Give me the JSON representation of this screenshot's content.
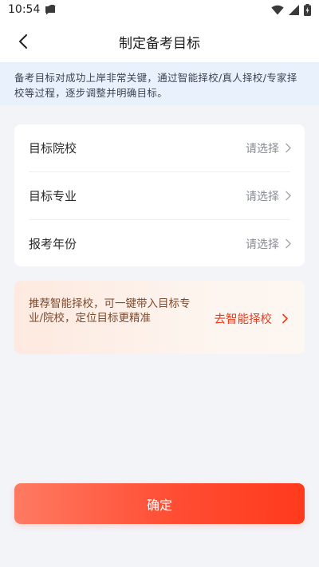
{
  "status_bar": {
    "time": "10:54"
  },
  "nav": {
    "title": "制定备考目标"
  },
  "notice": {
    "text": "备考目标对成功上岸非常关键，通过智能择校/真人择校/专家择校等过程，逐步调整并明确目标。"
  },
  "form": {
    "rows": [
      {
        "label": "目标院校",
        "value": "请选择"
      },
      {
        "label": "目标专业",
        "value": "请选择"
      },
      {
        "label": "报考年份",
        "value": "请选择"
      }
    ]
  },
  "promo": {
    "text": "推荐智能择校，可一键带入目标专业/院校，定位目标更精准",
    "cta": "去智能择校"
  },
  "confirm": {
    "label": "确定"
  },
  "colors": {
    "accent": "#ff4d33",
    "notice_bg": "#e9f1fc",
    "page_bg": "#f3f4f8",
    "promo_text": "#7b4a2f",
    "cta_text": "#ec3a1e"
  }
}
